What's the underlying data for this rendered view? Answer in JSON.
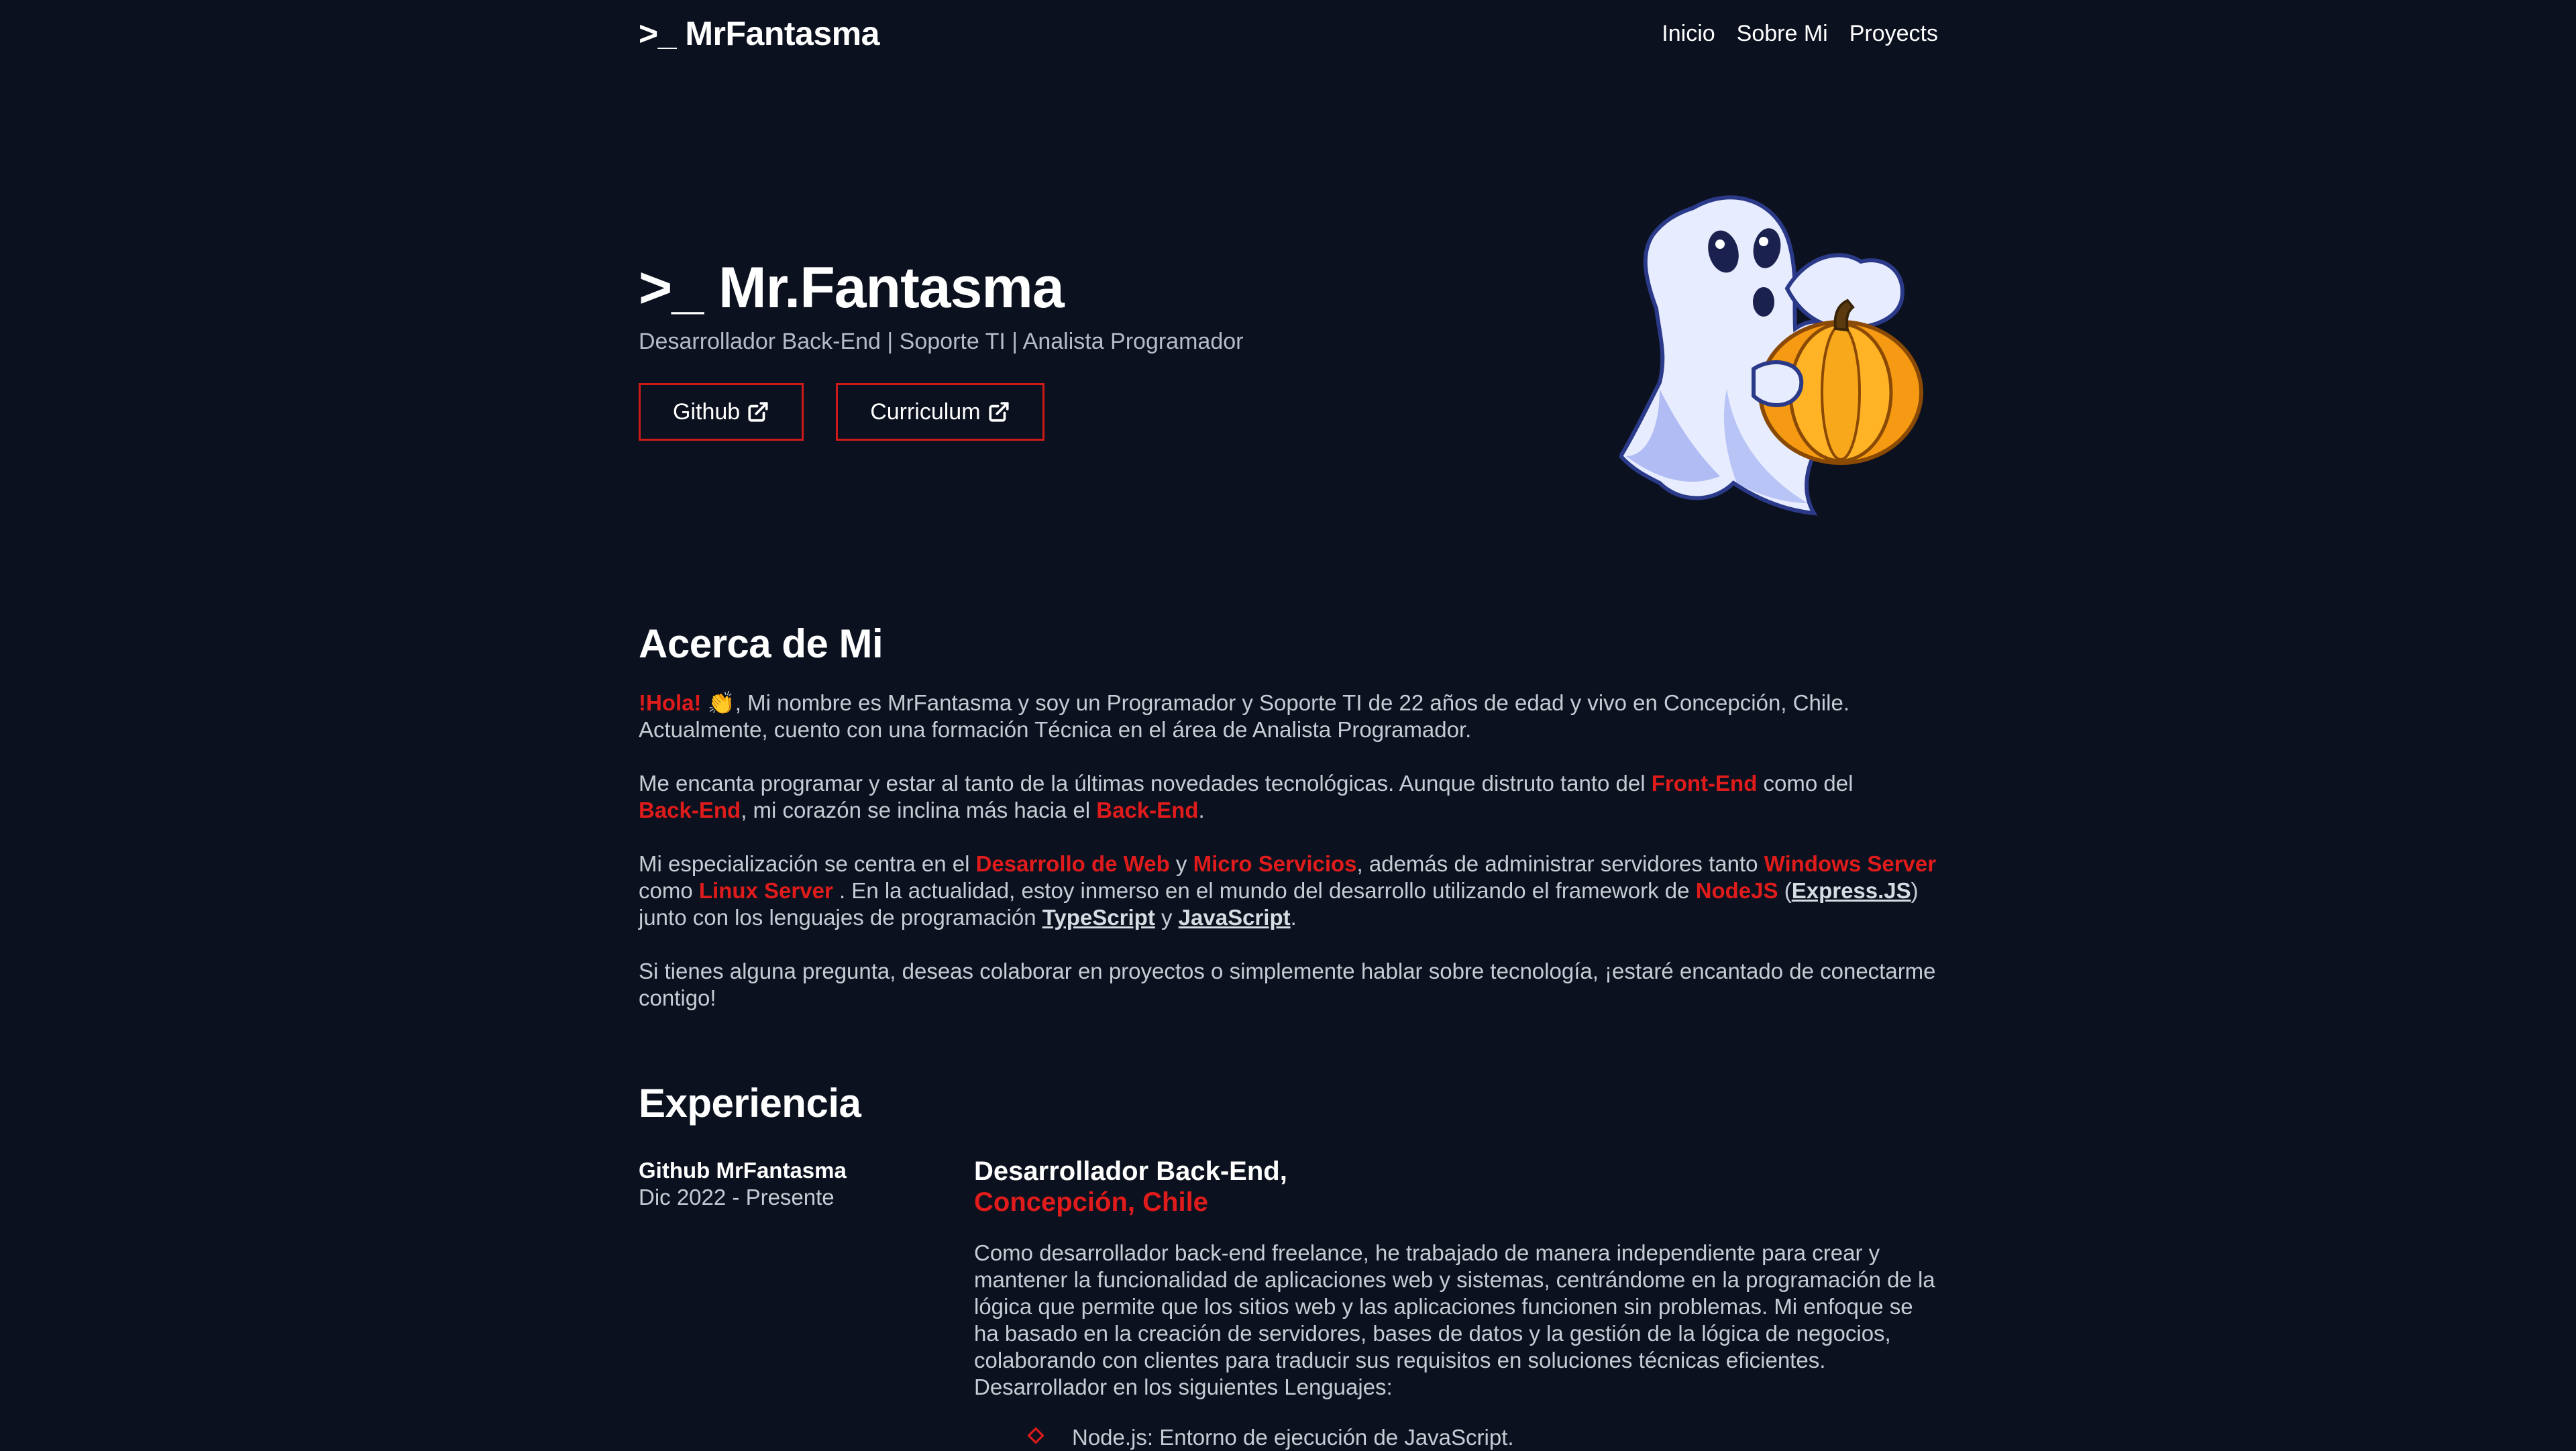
{
  "nav": {
    "brand": ">_ MrFantasma",
    "links": [
      "Inicio",
      "Sobre Mi",
      "Proyects"
    ]
  },
  "hero": {
    "title": ">_ Mr.Fantasma",
    "subtitle": "Desarrollador Back-End | Soporte TI | Analista Programador",
    "buttons": [
      "Github",
      "Curriculum"
    ],
    "image": "ghost-with-pumpkin"
  },
  "about": {
    "title": "Acerca de Mi",
    "p1": {
      "greeting": "!Hola!",
      "emoji": "👏",
      "text1": ", Mi nombre es MrFantasma y soy un Programador y Soporte TI de 22 años de edad y vivo en Concepción, Chile.",
      "text2": "Actualmente, cuento con una formación Técnica en el área de Analista Programador."
    },
    "p2": {
      "t1": "Me encanta programar y estar al tanto de la últimas novedades tecnológicas. Aunque distruto tanto del ",
      "h1": "Front-End",
      "t2": " como del ",
      "h2": "Back-End",
      "t3": ", mi corazón se inclina más hacia el ",
      "h3": "Back-End",
      "t4": "."
    },
    "p3": {
      "t1": "Mi especialización se centra en el ",
      "h1": "Desarrollo de Web",
      "t2": " y ",
      "h2": "Micro Servicios",
      "t3": ", además de administrar servidores tanto ",
      "h3": "Windows Server",
      "t4": " como ",
      "h4": "Linux Server",
      "t5": " . En la actualidad, estoy inmerso en el mundo del desarrollo utilizando el framework de ",
      "h5": "NodeJS",
      "t6": " (",
      "u1": "Express.JS",
      "t7": ") junto con los lenguajes de programación ",
      "u2": "TypeScript",
      "t8": " y ",
      "u3": "JavaScript",
      "t9": "."
    },
    "p4": "Si tienes alguna pregunta, deseas colaborar en proyectos o simplemente hablar sobre tecnología, ¡estaré encantado de conectarme contigo!"
  },
  "experience": {
    "title": "Experiencia",
    "items": [
      {
        "company": "Github MrFantasma",
        "date": "Dic 2022 - Presente",
        "role": "Desarrollador Back-End,",
        "location": "Concepción, Chile",
        "description": "Como desarrollador back-end freelance, he trabajado de manera independiente para crear y mantener la funcionalidad de aplicaciones web y sistemas, centrándome en la programación de la lógica que permite que los sitios web y las aplicaciones funcionen sin problemas. Mi enfoque se ha basado en la creación de servidores, bases de datos y la gestión de la lógica de negocios, colaborando con clientes para traducir sus requisitos en soluciones técnicas eficientes. Desarrollador en los siguientes Lenguajes:",
        "skills": [
          "Node.js: Entorno de ejecución de JavaScript."
        ]
      }
    ]
  },
  "colors": {
    "background": "#0b111e",
    "accent": "#e01b1b",
    "text": "#c7ccd4",
    "heading": "#ffffff"
  },
  "icons": [
    "external-link-icon",
    "diamond-bullet-icon"
  ]
}
